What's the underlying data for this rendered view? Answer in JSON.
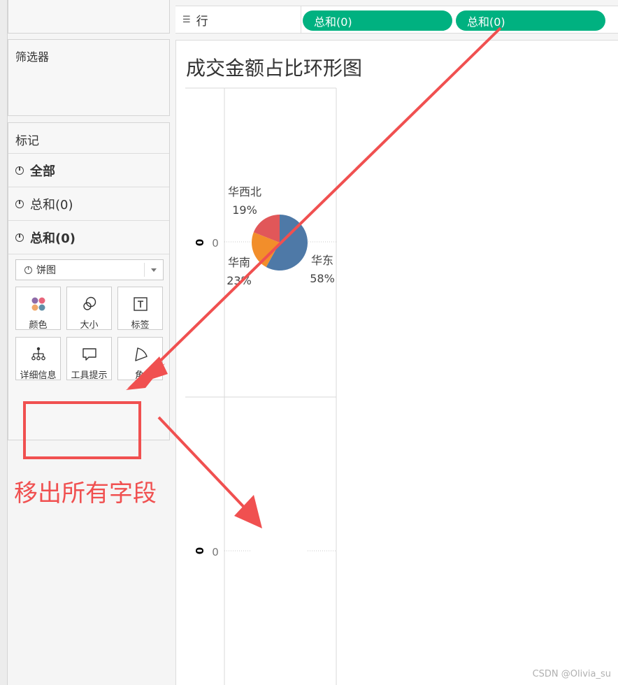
{
  "rows_shelf": {
    "label": "行",
    "pills": [
      "总和(0)",
      "总和(0)"
    ]
  },
  "filters": {
    "title": "筛选器"
  },
  "marks": {
    "title": "标记",
    "rows": [
      "全部",
      "总和(0)",
      "总和(0)"
    ],
    "mark_type": "饼图",
    "cards": [
      "颜色",
      "大小",
      "标签",
      "详细信息",
      "工具提示",
      "角"
    ]
  },
  "view": {
    "title": "成交金额占比环形图",
    "axis_value_top": "0",
    "axis_value_bottom": "0",
    "axis_field_top": "0",
    "axis_field_bottom": "0"
  },
  "chart_data": {
    "type": "pie",
    "categories": [
      "华东",
      "华南",
      "华西北"
    ],
    "values": [
      58,
      23,
      19
    ],
    "value_labels": [
      "58%",
      "23%",
      "19%"
    ],
    "colors": [
      "#4e79a7",
      "#f28e2b",
      "#e15759"
    ]
  },
  "annotation": {
    "text": "移出所有字段"
  },
  "watermark": "CSDN @Olivia_su"
}
